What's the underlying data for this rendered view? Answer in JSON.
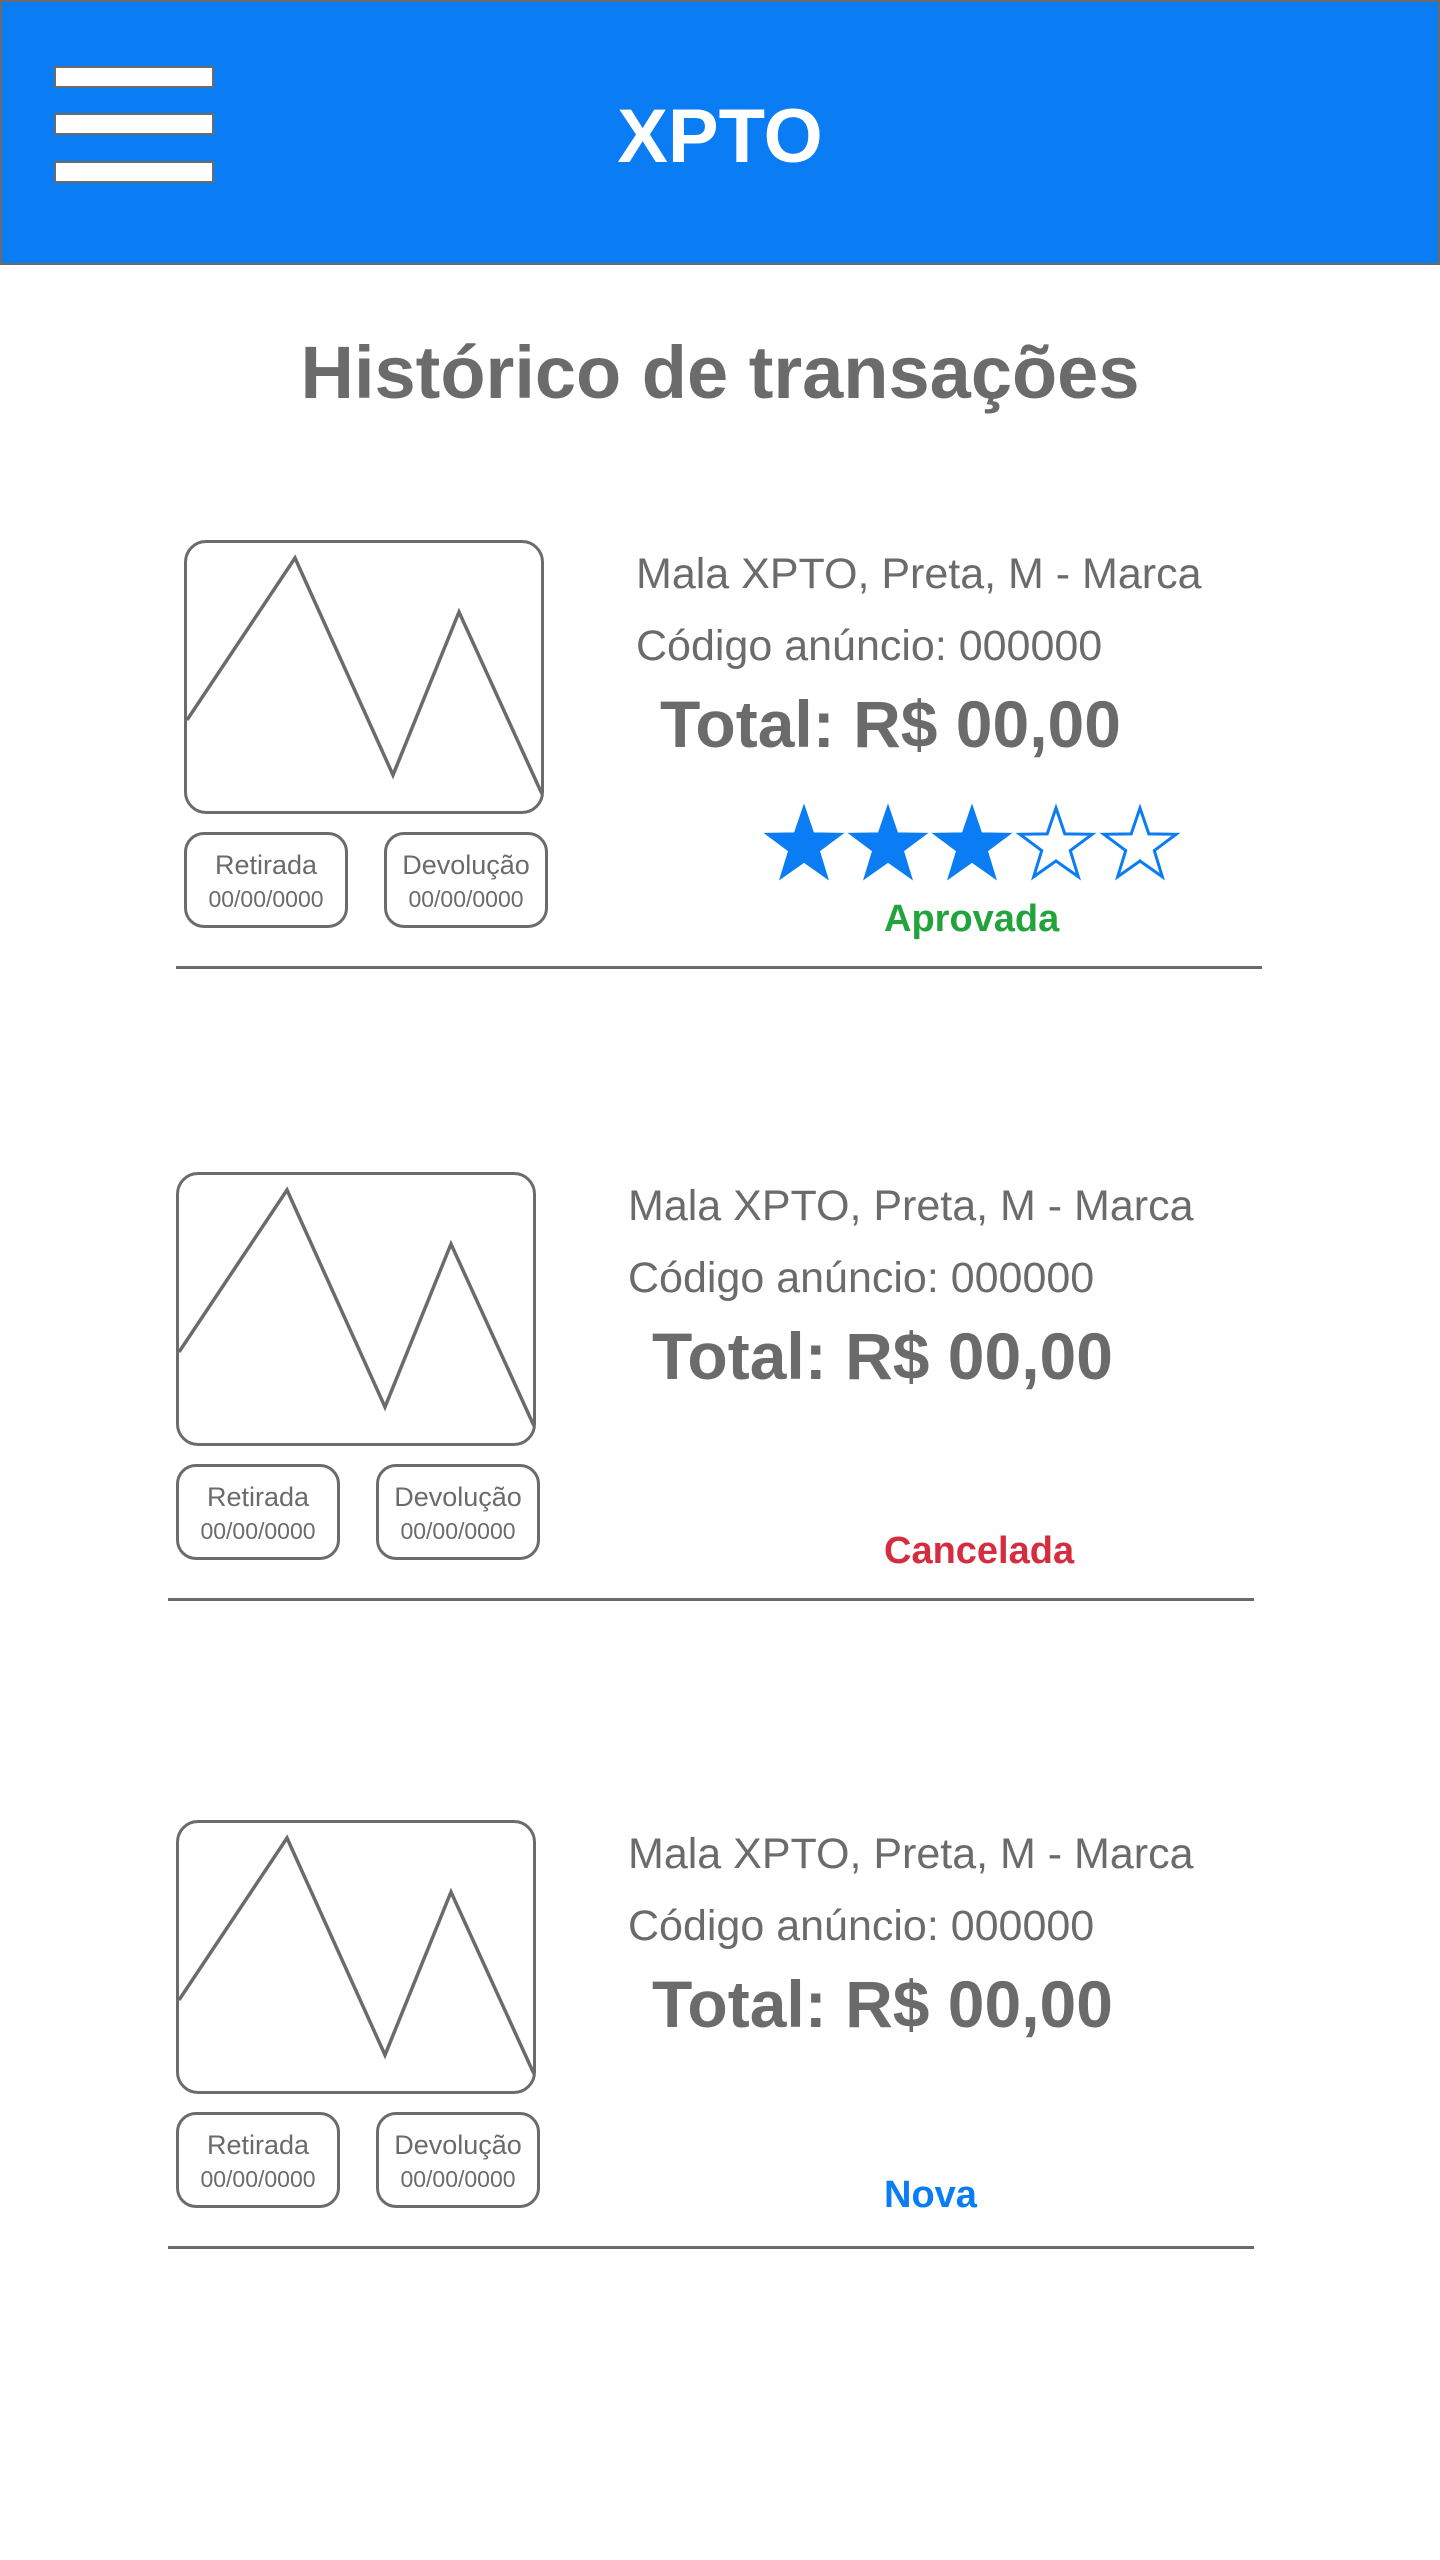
{
  "header": {
    "app_title": "XPTO",
    "menu_icon": "hamburger-menu-icon",
    "background_color": "#0a7cf4"
  },
  "page": {
    "title": "Histórico de transações"
  },
  "transactions": [
    {
      "item_name": "Mala XPTO, Preta, M - Marca",
      "ad_code": "Código anúncio: 000000",
      "total": "Total: R$ 00,00",
      "pickup_label": "Retirada",
      "pickup_date": "00/00/0000",
      "return_label": "Devolução",
      "return_date": "00/00/0000",
      "rating": 3,
      "rating_max": 5,
      "status": "Aprovada",
      "status_color": "#22a33c"
    },
    {
      "item_name": "Mala XPTO, Preta, M - Marca",
      "ad_code": "Código anúncio: 000000",
      "total": "Total: R$ 00,00",
      "pickup_label": "Retirada",
      "pickup_date": "00/00/0000",
      "return_label": "Devolução",
      "return_date": "00/00/0000",
      "status": "Cancelada",
      "status_color": "#d62c3f"
    },
    {
      "item_name": "Mala XPTO, Preta, M - Marca",
      "ad_code": "Código anúncio: 000000",
      "total": "Total: R$ 00,00",
      "pickup_label": "Retirada",
      "pickup_date": "00/00/0000",
      "return_label": "Devolução",
      "return_date": "00/00/0000",
      "status": "Nova",
      "status_color": "#0a7cf4"
    }
  ],
  "colors": {
    "text_gray": "#6b6b6b",
    "star_fill": "#0a7cf4"
  }
}
